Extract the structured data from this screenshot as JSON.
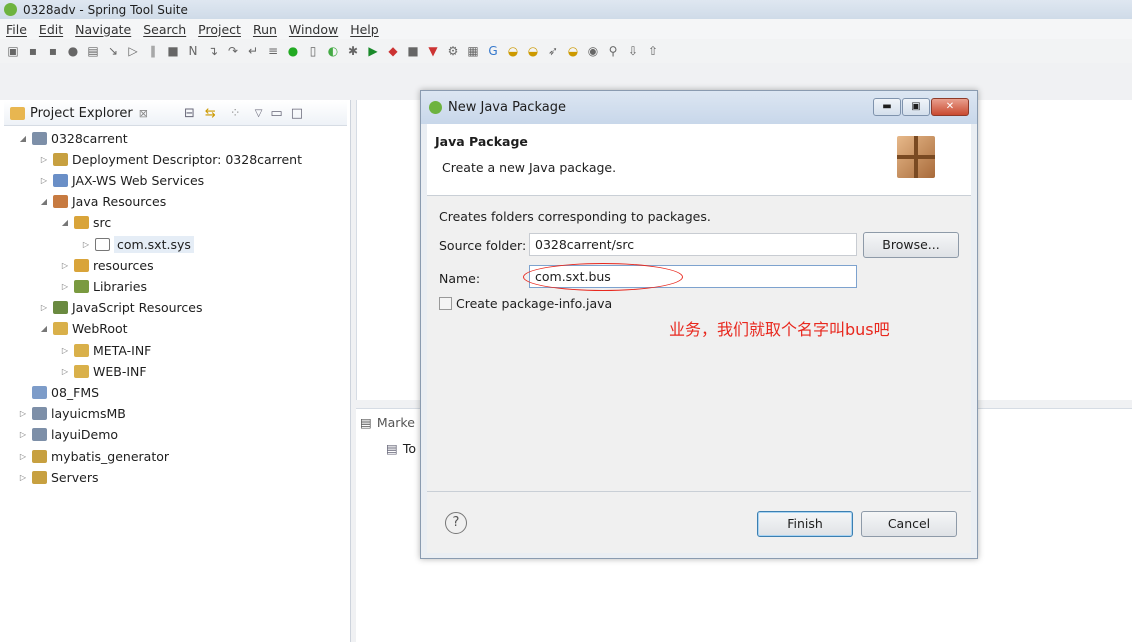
{
  "window": {
    "title": "0328adv - Spring Tool Suite"
  },
  "menu": [
    "File",
    "Edit",
    "Navigate",
    "Search",
    "Project",
    "Run",
    "Window",
    "Help"
  ],
  "explorer": {
    "tab_label": "Project Explorer",
    "tree": [
      {
        "label": "0328carrent",
        "level": 0,
        "expanded": true
      },
      {
        "label": "Deployment Descriptor: 0328carrent",
        "level": 1,
        "expanded": false
      },
      {
        "label": "JAX-WS Web Services",
        "level": 1,
        "expanded": false
      },
      {
        "label": "Java Resources",
        "level": 1,
        "expanded": true
      },
      {
        "label": "src",
        "level": 2,
        "expanded": true
      },
      {
        "label": "com.sxt.sys",
        "level": 3,
        "expanded": false,
        "selected": true
      },
      {
        "label": "resources",
        "level": 2,
        "expanded": false
      },
      {
        "label": "Libraries",
        "level": 2,
        "expanded": false
      },
      {
        "label": "JavaScript Resources",
        "level": 1,
        "expanded": false
      },
      {
        "label": "WebRoot",
        "level": 1,
        "expanded": true
      },
      {
        "label": "META-INF",
        "level": 2,
        "expanded": false
      },
      {
        "label": "WEB-INF",
        "level": 2,
        "expanded": false
      },
      {
        "label": "08_FMS",
        "level": 0,
        "expanded": null
      },
      {
        "label": "layuicmsMB",
        "level": 0,
        "expanded": false
      },
      {
        "label": "layuiDemo",
        "level": 0,
        "expanded": false
      },
      {
        "label": "mybatis_generator",
        "level": 0,
        "expanded": false
      },
      {
        "label": "Servers",
        "level": 0,
        "expanded": false
      }
    ]
  },
  "markers": {
    "tab_label": "Marke",
    "item": "To"
  },
  "dialog": {
    "title": "New Java Package",
    "header_title": "Java Package",
    "header_desc": "Create a new Java package.",
    "info": "Creates folders corresponding to packages.",
    "source_folder_label": "Source folder:",
    "source_folder_value": "0328carrent/src",
    "browse_label": "Browse...",
    "name_label": "Name:",
    "name_value": "com.sxt.bus",
    "checkbox_label": "Create package-info.java",
    "checkbox_checked": false,
    "finish_label": "Finish",
    "cancel_label": "Cancel",
    "help_icon": "?"
  },
  "annotation": {
    "text": "业务，我们就取个名字叫bus吧",
    "color": "#e8281e"
  }
}
